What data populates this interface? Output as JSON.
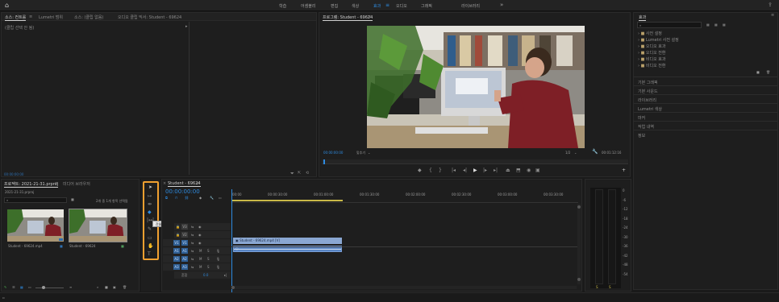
{
  "topbar": {
    "workspaces": [
      "학습",
      "어셈블리",
      "편집",
      "색상",
      "효과",
      "오디오",
      "그래픽",
      "라이브러리"
    ],
    "active": "효과"
  },
  "source_panel": {
    "tabs": [
      "소스: 컨트롤",
      "Lumetri 범위",
      "소스: (클립 없음)",
      "오디오 클립 믹서: Student - 69624"
    ],
    "clip_label": "(클립 선택 안 됨)",
    "timecode": "00:00:00:00"
  },
  "program_panel": {
    "title": "프로그램: Student - 69624",
    "timecode_in": "00:00:00:00",
    "zoom": "맞추기",
    "quality": "1/2",
    "duration": "00:01:12:16"
  },
  "effects_panel": {
    "title": "효과",
    "folders": [
      "사전 설정",
      "Lumetri 사전 설정",
      "오디오 효과",
      "오디오 전환",
      "비디오 효과",
      "비디오 전환"
    ],
    "sections": [
      "기본 그래픽",
      "기본 사운드",
      "라이브러리",
      "Lumetri 색상",
      "마커",
      "작업 내역",
      "정보"
    ]
  },
  "project_panel": {
    "tabs": [
      "프로젝트: 2021-21-31.prproj",
      "미디어 브라우저"
    ],
    "project_file": "2021-21-31.prproj",
    "selection_info": "2개 중 1개 항목 선택됨",
    "items": [
      {
        "name": "Student - 69624.mp4",
        "duration": ""
      },
      {
        "name": "Student - 69624",
        "duration": ""
      }
    ]
  },
  "tools": {
    "tooltip": "잔물결 도구 (B)",
    "icons": [
      "selection-tool-icon",
      "track-select-icon",
      "ripple-edit-icon",
      "razor-icon",
      "slip-icon",
      "pen-icon",
      "rectangle-icon",
      "hand-icon",
      "type-icon"
    ]
  },
  "timeline": {
    "sequence_name": "Student - 69624",
    "timecode": "00:00:00:00",
    "ruler": [
      "00:00",
      "00:00:30:00",
      "00:01:00:00",
      "00:01:30:00",
      "00:02:00:00",
      "00:02:30:00",
      "00:03:00:00",
      "00:03:30:00"
    ],
    "video_tracks": [
      "V3",
      "V2",
      "V1"
    ],
    "audio_tracks": [
      "A1",
      "A2",
      "A3"
    ],
    "master_label": "혼합",
    "master_value": "0.0",
    "video_clip": "Student - 69624.mp4 [V]"
  },
  "audio_meter": {
    "scale": [
      "0",
      "-6",
      "-12",
      "-18",
      "-24",
      "-30",
      "-36",
      "-42",
      "-48",
      "-54"
    ],
    "channels": [
      "S",
      "S"
    ]
  },
  "colors": {
    "accent": "#2e8be0",
    "tool_highlight": "#f0a030",
    "clip_video": "#8aa7d2",
    "clip_audio": "#5a86c4"
  }
}
